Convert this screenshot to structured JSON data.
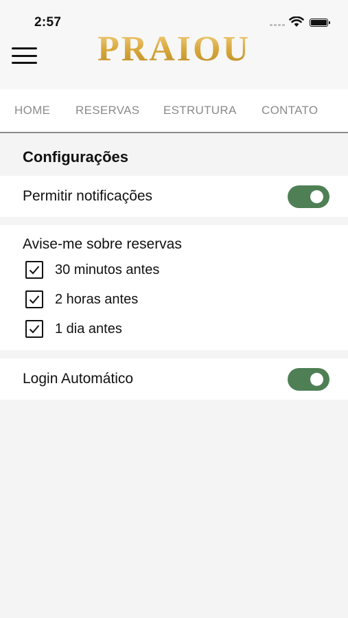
{
  "status_bar": {
    "time": "2:57"
  },
  "header": {
    "logo": "PRAIOU"
  },
  "nav": {
    "items": [
      "HOME",
      "RESERVAS",
      "ESTRUTURA",
      "CONTATO"
    ]
  },
  "settings": {
    "title": "Configurações",
    "notifications": {
      "label": "Permitir notificações",
      "enabled": true
    },
    "reminders": {
      "title": "Avise-me sobre reservas",
      "options": [
        {
          "label": "30 minutos antes",
          "checked": true
        },
        {
          "label": "2 horas antes",
          "checked": true
        },
        {
          "label": "1 dia antes",
          "checked": true
        }
      ]
    },
    "auto_login": {
      "label": "Login Automático",
      "enabled": true
    }
  },
  "colors": {
    "toggle_on": "#4f7f55",
    "logo_gold": "#d9a93c",
    "nav_text": "#8a8a8a"
  }
}
